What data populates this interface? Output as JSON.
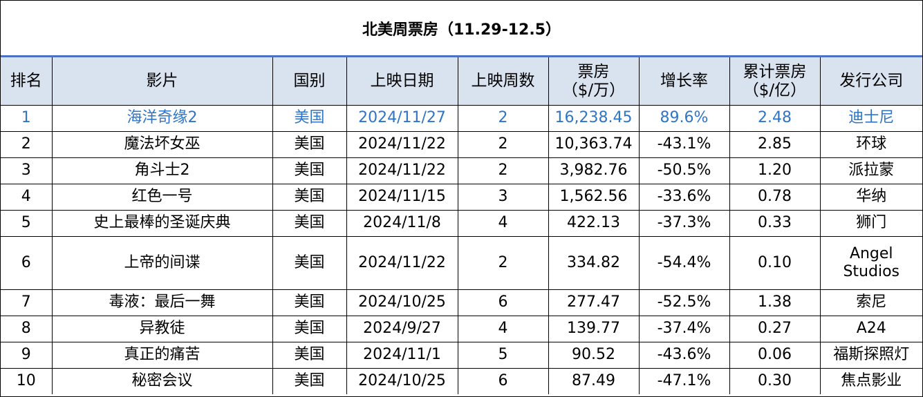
{
  "title": "北美周票房（11.29-12.5）",
  "headers": {
    "rank": "排名",
    "film": "影片",
    "country": "国别",
    "release_date": "上映日期",
    "weeks": "上映周数",
    "box_office_line1": "票房",
    "box_office_line2": "（$/万）",
    "growth": "增长率",
    "cumulative_line1": "累计票房",
    "cumulative_line2": "（$/亿）",
    "distributor": "发行公司"
  },
  "rows": [
    {
      "rank": "1",
      "film": "海洋奇缘2",
      "country": "美国",
      "release_date": "2024/11/27",
      "weeks": "2",
      "box_office": "16,238.45",
      "growth": "89.6%",
      "cumulative": "2.48",
      "distributor": "迪士尼"
    },
    {
      "rank": "2",
      "film": "魔法坏女巫",
      "country": "美国",
      "release_date": "2024/11/22",
      "weeks": "2",
      "box_office": "10,363.74",
      "growth": "-43.1%",
      "cumulative": "2.85",
      "distributor": "环球"
    },
    {
      "rank": "3",
      "film": "角斗士2",
      "country": "美国",
      "release_date": "2024/11/22",
      "weeks": "2",
      "box_office": "3,982.76",
      "growth": "-50.5%",
      "cumulative": "1.20",
      "distributor": "派拉蒙"
    },
    {
      "rank": "4",
      "film": "红色一号",
      "country": "美国",
      "release_date": "2024/11/15",
      "weeks": "3",
      "box_office": "1,562.56",
      "growth": "-33.6%",
      "cumulative": "0.78",
      "distributor": "华纳"
    },
    {
      "rank": "5",
      "film": "史上最棒的圣诞庆典",
      "country": "美国",
      "release_date": "2024/11/8",
      "weeks": "4",
      "box_office": "422.13",
      "growth": "-37.3%",
      "cumulative": "0.33",
      "distributor": "狮门"
    },
    {
      "rank": "6",
      "film": "上帝的间谍",
      "country": "美国",
      "release_date": "2024/11/22",
      "weeks": "2",
      "box_office": "334.82",
      "growth": "-54.4%",
      "cumulative": "0.10",
      "distributor": "Angel Studios"
    },
    {
      "rank": "7",
      "film": "毒液：最后一舞",
      "country": "美国",
      "release_date": "2024/10/25",
      "weeks": "6",
      "box_office": "277.47",
      "growth": "-52.5%",
      "cumulative": "1.38",
      "distributor": "索尼"
    },
    {
      "rank": "8",
      "film": "异教徒",
      "country": "美国",
      "release_date": "2024/9/27",
      "weeks": "4",
      "box_office": "139.77",
      "growth": "-37.4%",
      "cumulative": "0.27",
      "distributor": "A24"
    },
    {
      "rank": "9",
      "film": "真正的痛苦",
      "country": "美国",
      "release_date": "2024/11/1",
      "weeks": "5",
      "box_office": "90.52",
      "growth": "-43.6%",
      "cumulative": "0.06",
      "distributor": "福斯探照灯"
    },
    {
      "rank": "10",
      "film": "秘密会议",
      "country": "美国",
      "release_date": "2024/10/25",
      "weeks": "6",
      "box_office": "87.49",
      "growth": "-47.1%",
      "cumulative": "0.30",
      "distributor": "焦点影业"
    }
  ],
  "colors": {
    "header_bg": "#d9e2ef",
    "highlight_text": "#2e75c8",
    "title_rule": "#4a72c4"
  }
}
